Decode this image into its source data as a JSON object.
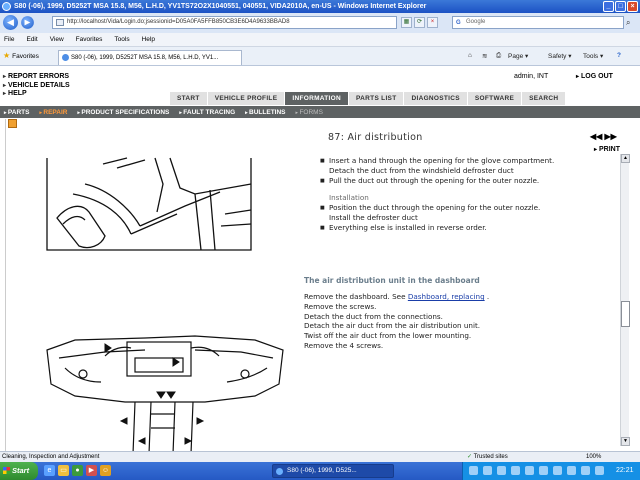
{
  "window": {
    "title": "S80 (-06), 1999, D5252T MSA 15.8, M56, L.H.D, YV1TS72O2X1040551, 040551, VIDA2010A, en-US - Windows Internet Explorer"
  },
  "address": {
    "url": "http://localhost/Vida/Login.do;jsessionid=D05A0FA5FFB850CB3E6D4A9633BBAD8",
    "search_placeholder": "Google"
  },
  "menu": {
    "items": [
      "File",
      "Edit",
      "View",
      "Favorites",
      "Tools",
      "Help"
    ]
  },
  "favbar": {
    "favorites_label": "Favorites",
    "tab_title": "S80 (-06), 1999, D5252T MSA 15.8, M56, L.H.D, YV1...",
    "page_label": "Page ▾",
    "safety_label": "Safety ▾",
    "tools_label": "Tools ▾",
    "help_label": "?"
  },
  "left_links": [
    "REPORT ERRORS",
    "VEHICLE DETAILS",
    "HELP"
  ],
  "user": {
    "name": "admin, INT",
    "logout": "LOG OUT"
  },
  "main_tabs": [
    "START",
    "VEHICLE PROFILE",
    "INFORMATION",
    "PARTS LIST",
    "DIAGNOSTICS",
    "SOFTWARE",
    "SEARCH"
  ],
  "active_main_tab": "INFORMATION",
  "sub_nav": [
    "PARTS",
    "REPAIR",
    "PRODUCT SPECIFICATIONS",
    "FAULT TRACING",
    "BULLETINS",
    "FORMS"
  ],
  "content": {
    "title": "87: Air distribution",
    "print_label": "PRINT",
    "nav_arrows": "◀◀ ▶▶",
    "bullets_a": [
      "Insert a hand through the opening for the glove compartment. Detach the duct from the windshield defroster duct",
      "Pull the duct out through the opening for the outer nozzle."
    ],
    "installation_label": "Installation",
    "bullets_b": [
      "Position the duct through the opening for the outer nozzle. Install the defroster duct",
      "Everything else is installed in reverse order."
    ],
    "section_heading": "The air distribution unit in the dashboard",
    "step1_prefix": "Remove the dashboard. See ",
    "step1_link": "Dashboard, replacing",
    "step1_suffix": " .",
    "steps": [
      "Remove the screws.",
      "Detach the duct from the connections.",
      "Detach the air duct from the air distribution unit.",
      "Twist off the air duct from the lower mounting.",
      "Remove the 4 screws."
    ]
  },
  "status": {
    "text": "Cleaning, Inspection and Adjustment",
    "zone": "Trusted sites",
    "zoom": "100%"
  },
  "taskbar": {
    "start": "Start",
    "task_item": "S80 (-06), 1999, D525...",
    "clock": "22:21"
  }
}
